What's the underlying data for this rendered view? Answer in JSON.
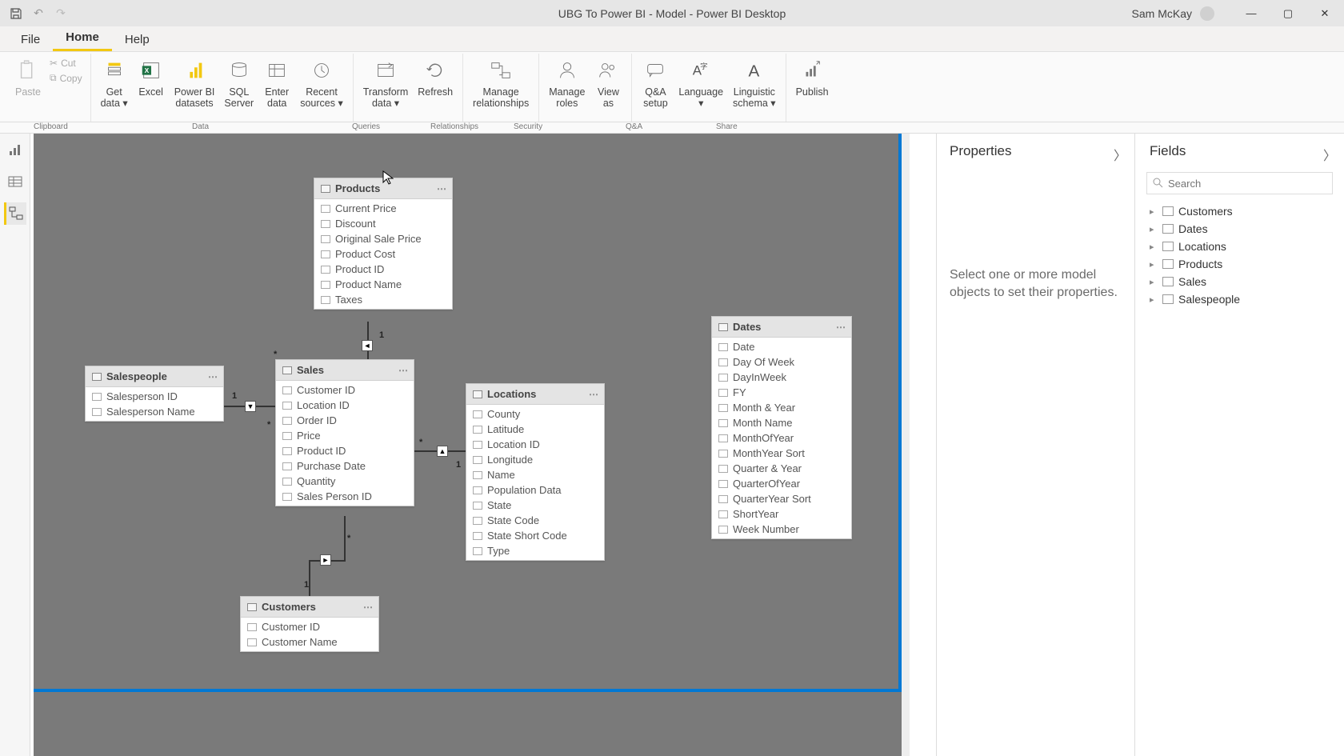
{
  "title": "UBG To Power BI - Model - Power BI Desktop",
  "user": "Sam McKay",
  "menu": {
    "file": "File",
    "home": "Home",
    "help": "Help"
  },
  "ribbon": {
    "paste": "Paste",
    "cut": "Cut",
    "copy": "Copy",
    "get_data": "Get\ndata",
    "excel": "Excel",
    "pbi_datasets": "Power BI\ndatasets",
    "sql": "SQL\nServer",
    "enter_data": "Enter\ndata",
    "recent": "Recent\nsources",
    "transform": "Transform\ndata",
    "refresh": "Refresh",
    "manage_rel": "Manage\nrelationships",
    "manage_roles": "Manage\nroles",
    "view_as": "View\nas",
    "qa_setup": "Q&A\nsetup",
    "language": "Language",
    "ling": "Linguistic\nschema",
    "publish": "Publish",
    "groups": {
      "clipboard": "Clipboard",
      "data": "Data",
      "queries": "Queries",
      "relationships": "Relationships",
      "security": "Security",
      "qa": "Q&A",
      "share": "Share"
    }
  },
  "tables": {
    "products": {
      "title": "Products",
      "fields": [
        "Current Price",
        "Discount",
        "Original Sale Price",
        "Product Cost",
        "Product ID",
        "Product Name",
        "Taxes"
      ]
    },
    "salespeople": {
      "title": "Salespeople",
      "fields": [
        "Salesperson ID",
        "Salesperson Name"
      ]
    },
    "sales": {
      "title": "Sales",
      "fields": [
        "Customer ID",
        "Location ID",
        "Order ID",
        "Price",
        "Product ID",
        "Purchase Date",
        "Quantity",
        "Sales Person ID"
      ]
    },
    "locations": {
      "title": "Locations",
      "fields": [
        "County",
        "Latitude",
        "Location ID",
        "Longitude",
        "Name",
        "Population Data",
        "State",
        "State Code",
        "State Short Code",
        "Type"
      ]
    },
    "dates": {
      "title": "Dates",
      "fields": [
        "Date",
        "Day Of Week",
        "DayInWeek",
        "FY",
        "Month & Year",
        "Month Name",
        "MonthOfYear",
        "MonthYear Sort",
        "Quarter & Year",
        "QuarterOfYear",
        "QuarterYear Sort",
        "ShortYear",
        "Week Number"
      ]
    },
    "customers": {
      "title": "Customers",
      "fields": [
        "Customer ID",
        "Customer Name"
      ]
    }
  },
  "properties": {
    "title": "Properties",
    "message": "Select one or more model objects to set their properties."
  },
  "fields_pane": {
    "title": "Fields",
    "search_placeholder": "Search",
    "items": [
      "Customers",
      "Dates",
      "Locations",
      "Products",
      "Sales",
      "Salespeople"
    ]
  }
}
